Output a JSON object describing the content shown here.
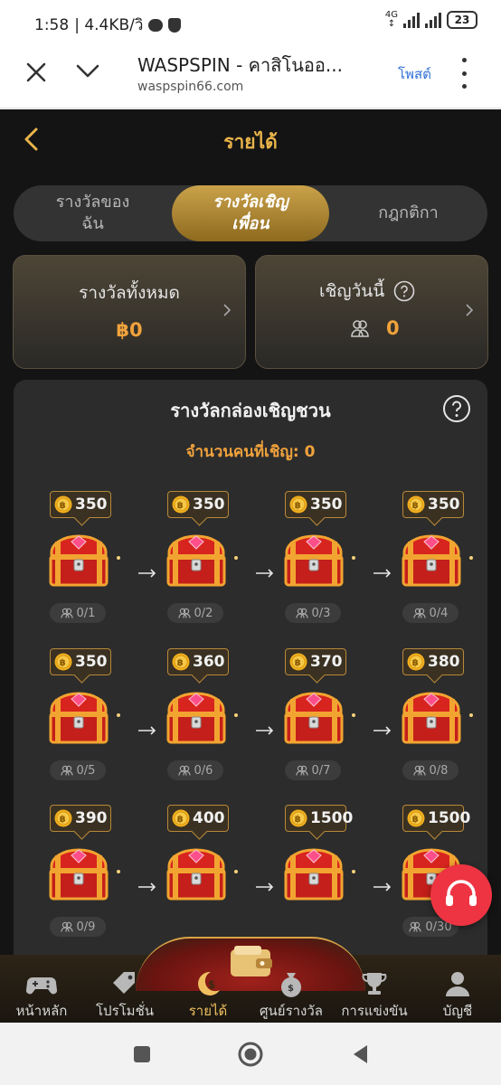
{
  "status_bar": {
    "time": "1:58",
    "speed": "| 4.4KB/วิ",
    "network": "4G",
    "battery": "23"
  },
  "browser": {
    "title": "WASPSPIN - คาสิโนออ...",
    "url": "waspspin66.com",
    "post_label": "โพสต์",
    "icons": [
      "close-icon",
      "chevron-down-icon",
      "more-icon"
    ]
  },
  "header": {
    "title": "รายได้",
    "back_icon": "chevron-left-icon"
  },
  "tabs": [
    {
      "label_1": "รางวัลของ",
      "label_2": "ฉัน"
    },
    {
      "label_1": "รางวัลเชิญ",
      "label_2": "เพื่อน"
    },
    {
      "label_1": "กฎกติกา",
      "label_2": ""
    }
  ],
  "active_tab": 1,
  "summary": {
    "total": {
      "label": "รางวัลทั้งหมด",
      "value": "฿0"
    },
    "today": {
      "label": "เชิญวันนี้",
      "value": "0"
    }
  },
  "box_panel": {
    "title": "รางวัลกล่องเชิญชวน",
    "invited_text": "จำนวนคนที่เชิญ: 0",
    "items": [
      {
        "reward": "350",
        "progress": "0/1"
      },
      {
        "reward": "350",
        "progress": "0/2"
      },
      {
        "reward": "350",
        "progress": "0/3"
      },
      {
        "reward": "350",
        "progress": "0/4"
      },
      {
        "reward": "350",
        "progress": "0/5"
      },
      {
        "reward": "360",
        "progress": "0/6"
      },
      {
        "reward": "370",
        "progress": "0/7"
      },
      {
        "reward": "380",
        "progress": "0/8"
      },
      {
        "reward": "390",
        "progress": "0/9"
      },
      {
        "reward": "400",
        "progress": ""
      },
      {
        "reward": "1500",
        "progress": ""
      },
      {
        "reward": "1500",
        "progress": "0/30"
      }
    ]
  },
  "bottom_nav": [
    {
      "label": "หน้าหลัก",
      "icon": "gamepad-icon"
    },
    {
      "label": "โปรโมชั่น",
      "icon": "tag-icon"
    },
    {
      "label": "รายได้",
      "icon": "moon-coin-icon"
    },
    {
      "label": "ศูนย์รางวัล",
      "icon": "money-bag-icon"
    },
    {
      "label": "การแข่งขัน",
      "icon": "trophy-icon"
    },
    {
      "label": "บัญชี",
      "icon": "user-icon"
    }
  ],
  "active_nav": 2,
  "colors": {
    "accent_gold": "#e9b44a",
    "value_orange": "#f0a23c",
    "background": "#141414",
    "support_red": "#ee3442"
  }
}
